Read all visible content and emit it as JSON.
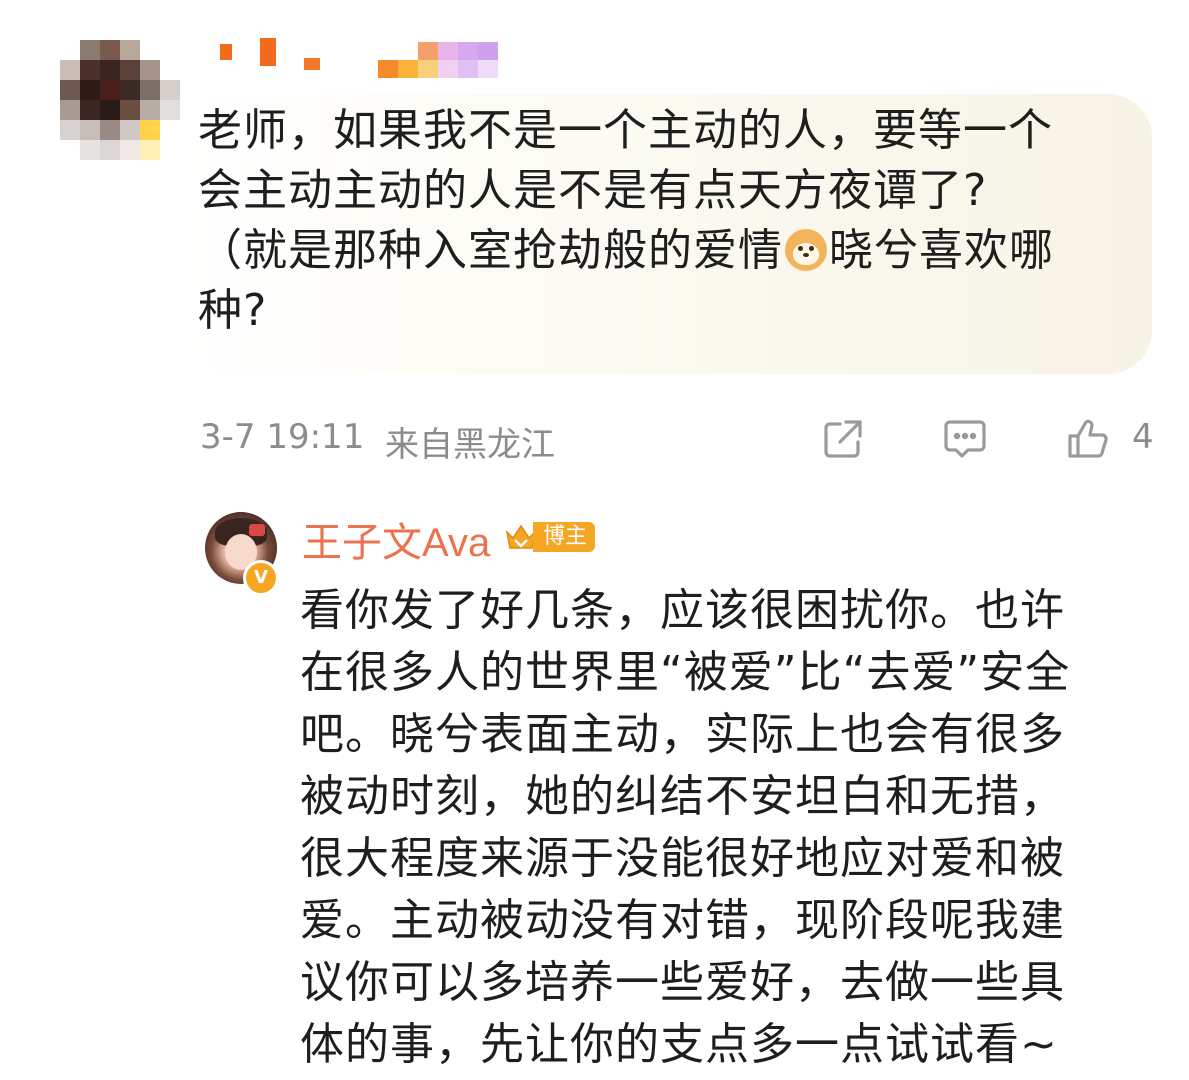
{
  "comment": {
    "text_before_emoji": "老师，如果我不是一个主动的人，要等一个\n会主动主动的人是不是有点天方夜谭了?\n（就是那种入室抢劫般的爱情",
    "text_after_emoji": "晓兮喜欢哪\n种?",
    "emoji": "dog-face-icon",
    "time": "3-7 19:11",
    "location": "来自黑龙江",
    "like_count": "4"
  },
  "reply": {
    "author": "王子文Ava",
    "badge": "博主",
    "verified": "V",
    "text": "看你发了好几条，应该很困扰你。也许\n在很多人的世界里“被爱”比“去爱”安全\n吧。晓兮表面主动，实际上也会有很多\n被动时刻，她的纠结不安坦白和无措，\n很大程度来源于没能很好地应对爱和被\n爱。主动被动没有对错，现阶段呢我建\n议你可以多培养一些爱好，去做一些具\n体的事，先让你的支点多一点试试看~"
  },
  "colors": {
    "author_orange": "#eb7350",
    "badge_orange": "#f5a623",
    "meta_gray": "#8c8c8c",
    "bubble_bg": "#f7f4e6"
  }
}
